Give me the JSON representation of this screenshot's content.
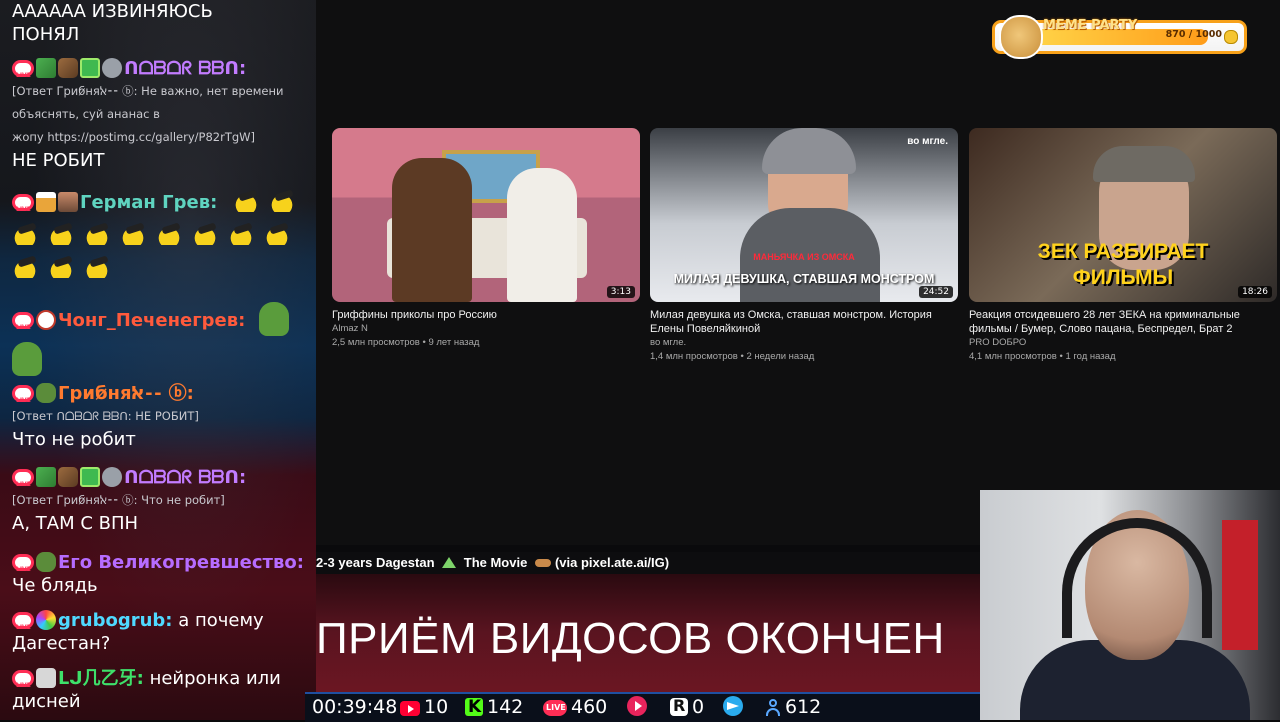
{
  "chat": {
    "m1": {
      "text1": "АААААА ИЗВИНЯЮСЬ",
      "text2": "ПОНЯЛ"
    },
    "m2": {
      "name": "ᑎᗝᗷᗝᖇ ᗷᗷᑎ:",
      "reply1": "[Ответ Гриб⁠̷ня⁠ﭏ⁠⁃⁠⁃ ⁠ⓑ: Не важно, нет времени",
      "reply2": "объяснять, суй ананас в",
      "reply3": "жопу https://postimg.cc/gallery/P82rTgW]",
      "text": "НЕ РОБИТ"
    },
    "m3": {
      "name": "Герман Грев:"
    },
    "m4": {
      "name": "Чонг_Печенегрев:"
    },
    "m5": {
      "name": "Гриб⁠̷ня⁠ﭏ⁠⁃⁠⁃ ⁠ⓑ:",
      "reply": "[Ответ ᑎᗝᗷᗝᖇ ᗷᗷᑎ: НЕ РОБИТ]",
      "text": "Что не робит"
    },
    "m6": {
      "name": "ᑎᗝᗷᗝᖇ ᗷᗷᑎ:",
      "reply": "[Ответ Гриб⁠̷ня⁠ﭏ⁠⁃⁠⁃ ⁠ⓑ: Что не робит]",
      "text": "А, ТАМ С ВПН"
    },
    "m7": {
      "name": "Его Великогревшество:",
      "text": "Че блядь"
    },
    "m8": {
      "name": "grubogrub:",
      "text1": " а почему",
      "text2": "Дагестан?"
    },
    "m9": {
      "name": "ᒪᒍ几乙牙:",
      "text1": " нейронка или",
      "text2": "дисней"
    }
  },
  "videos": [
    {
      "title": "Гриффины приколы про Россию",
      "channel": "Almaz N",
      "stats": "2,5 млн просмотров • 9 лет назад",
      "duration": "3:13"
    },
    {
      "title": "Милая девушка из Омска, ставшая монстром. История Елены Повеляйкиной",
      "channel": "во мгле.",
      "stats": "1,4 млн просмотров • 2 недели назад",
      "duration": "24:52",
      "thumb_caption": "МИЛАЯ ДЕВУШКА, СТАВШАЯ МОНСТРОМ",
      "thumb_tag": "во мгле.",
      "thumb_stamp": "МАНЬЯЧКА ИЗ ОМСКА"
    },
    {
      "title": "Реакция отсидевшего 28 лет ЗЕКА на криминальные фильмы / Бумер, Слово пацана, Беспредел, Брат 2",
      "channel": "PRO DOБРО",
      "stats": "4,1 млн просмотров • 1 год назад",
      "duration": "18:26",
      "thumb_caption1": "ЗЕК РАЗБИРАЕТ",
      "thumb_caption2": "ФИЛЬМЫ"
    }
  ],
  "meme_party": {
    "label": "MEME PARTY",
    "value": "870 / 1000",
    "progress": 0.87
  },
  "ticker": {
    "text1": "2-3 years Dagestan",
    "text2": " The Movie ",
    "text3": "(via pixel.ate.ai/IG)"
  },
  "banner": {
    "text": "ПРИЁМ ВИДОСОВ ОКОНЧЕН"
  },
  "status": {
    "timer": "00:39:48",
    "youtube": "10",
    "kick": "142",
    "vklive": "460",
    "play": "",
    "rutube": "0",
    "telegram": "",
    "viewers": "612"
  },
  "colors": {
    "accent": "#f7a11a",
    "live": "#ff2d55",
    "kick": "#53fc18",
    "youtube": "#ff0033"
  }
}
